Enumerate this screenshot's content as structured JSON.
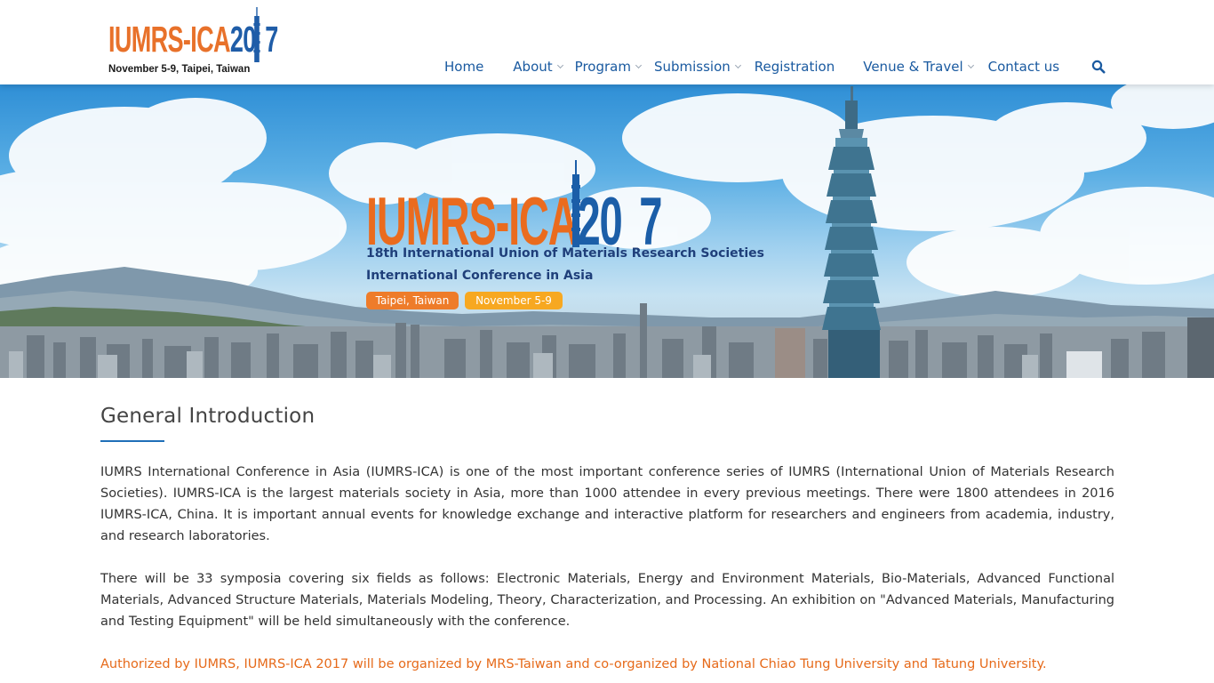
{
  "header": {
    "logo": {
      "word_orange": "IUMRS-ICA",
      "word_blue_left": "2",
      "word_blue_mid": "0",
      "word_blue_right": "7",
      "tagline": "November 5-9, Taipei, Taiwan"
    },
    "nav": [
      {
        "label": "Home",
        "has_dropdown": false
      },
      {
        "label": "About",
        "has_dropdown": true
      },
      {
        "label": "Program",
        "has_dropdown": true
      },
      {
        "label": "Submission",
        "has_dropdown": true
      },
      {
        "label": "Registration",
        "has_dropdown": false
      },
      {
        "label": "Venue & Travel",
        "has_dropdown": true
      },
      {
        "label": "Contact us",
        "has_dropdown": false
      }
    ],
    "search_icon": "search-icon"
  },
  "hero": {
    "word_orange": "IUMRS-ICA",
    "word_blue_left": "20",
    "word_blue_right": "7",
    "line1": "18th International Union of Materials Research Societies",
    "line2": "International Conference in Asia",
    "location_badge": "Taipei, Taiwan",
    "date_badge": "November 5-9"
  },
  "main": {
    "title": "General Introduction",
    "paragraphs": [
      "IUMRS International Conference in Asia (IUMRS-ICA) is one of the most important conference series of IUMRS (International Union of Materials Research Societies). IUMRS-ICA is the largest materials society in Asia, more than 1000 attendee in every previous meetings. There were 1800 attendees in 2016 IUMRS-ICA, China. It is important annual events for knowledge exchange and interactive platform for researchers and engineers from academia, industry, and research laboratories.",
      "There will be 33 symposia covering six fields as follows: Electronic Materials, Energy and Environment Materials, Bio-Materials, Advanced Functional Materials, Advanced Structure Materials, Materials Modeling, Theory, Characterization, and Processing. An exhibition on \"Advanced Materials, Manufacturing and Testing Equipment\" will be held simultaneously with the conference."
    ],
    "highlight": "Authorized by IUMRS, IUMRS-ICA 2017 will be organized by MRS-Taiwan and co-organized by National Chiao Tung University and Tatung University."
  },
  "colors": {
    "brand_orange": "#e8712a",
    "brand_blue": "#1f5da8",
    "nav_text": "#1a5aa0",
    "accent_underline": "#1f6fb8",
    "highlight_text": "#e66a1a"
  }
}
